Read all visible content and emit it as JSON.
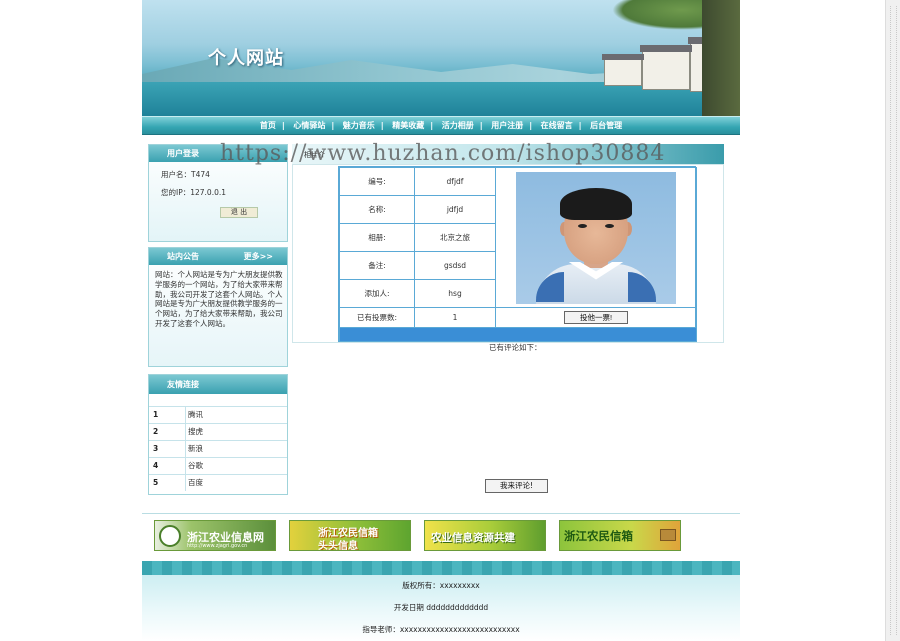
{
  "site": {
    "title": "个人网站"
  },
  "nav": [
    "首页",
    "心情驿站",
    "魅力音乐",
    "精美收藏",
    "活力相册",
    "用户注册",
    "在线留言",
    "后台管理"
  ],
  "login": {
    "title": "用户登录",
    "username_line": "用户名：T474",
    "ip_line": "您的IP：127.0.0.1",
    "logout": "退 出"
  },
  "notice": {
    "title": "站内公告",
    "more": "更多>>",
    "text": "网站：个人网站是专为广大朋友提供教学服务的一个网站，为了给大家带来帮助，我公司开发了这套个人网站。个人网站是专为广大朋友提供教学服务的一个网站，为了给大家带来帮助，我公司开发了这套个人网站。"
  },
  "links": {
    "title": "友情连接",
    "items": [
      {
        "num": "1",
        "name": "腾讯"
      },
      {
        "num": "2",
        "name": "搜虎"
      },
      {
        "num": "3",
        "name": "新浪"
      },
      {
        "num": "4",
        "name": "谷歌"
      },
      {
        "num": "5",
        "name": "百度"
      }
    ]
  },
  "main": {
    "title": "相片介",
    "watermark": "https://www.huzhan.com/ishop30884",
    "rows": [
      {
        "label": "编号:",
        "value": "dfjdf"
      },
      {
        "label": "名称:",
        "value": "jdfjd"
      },
      {
        "label": "相册:",
        "value": "北京之旅"
      },
      {
        "label": "备注:",
        "value": "gsdsd"
      },
      {
        "label": "添加人:",
        "value": "hsg"
      }
    ],
    "votes_label": "已有投票数:",
    "votes_value": "1",
    "vote_button": "投他一票!",
    "comments_label": "已有评论如下：",
    "comment_button": "我来评论!"
  },
  "ads": {
    "ad1": "浙江农业信息网",
    "ad1_sub": "http://www.zjagri.gov.cn",
    "ad2_line1": "浙江农民信箱",
    "ad2_line2": "头头信息",
    "ad3": "农业信息资源共建",
    "ad4": "浙江农民信箱"
  },
  "footer": {
    "copyright": "版权所有：xxxxxxxxx",
    "date": "开发日期 ddddddddddddd",
    "teacher": "指导老师：xxxxxxxxxxxxxxxxxxxxxxxxxxx"
  }
}
